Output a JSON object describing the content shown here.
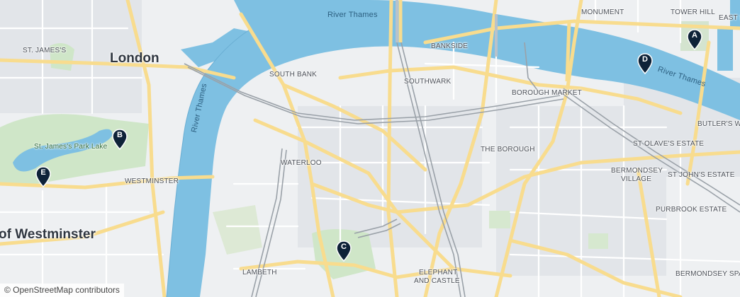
{
  "labels": {
    "river_top": "River Thames",
    "river_left": "River Thames",
    "river_right": "River Thames",
    "london": "London",
    "westminster": "of Westminster",
    "st_jamess": "ST. JAMES'S",
    "st_james_park_lake": "St. James's Park Lake",
    "westminster_small": "WESTMINSTER",
    "south_bank": "SOUTH BANK",
    "waterloo": "WATERLOO",
    "lambeth": "LAMBETH",
    "southwark": "SOUTHWARK",
    "bankside": "BANKSIDE",
    "borough_market": "BOROUGH MARKET",
    "the_borough": "THE BOROUGH",
    "elephant_and_castle_1": "ELEPHANT",
    "elephant_and_castle_2": "AND CASTLE",
    "monument": "MONUMENT",
    "tower_hill": "TOWER HILL",
    "east_sm": "EAST SM",
    "butlers_wharf": "BUTLER'S WHA",
    "st_olaves_estate": "ST OLAVE'S ESTATE",
    "st_johns_estate": "ST JOHN'S ESTATE",
    "bermondsey_village_1": "BERMONDSEY",
    "bermondsey_village_2": "VILLAGE",
    "purbrook_estate": "PURBROOK ESTATE",
    "bermondsey_spa": "BERMONDSEY SPA"
  },
  "markers": [
    {
      "id": "A",
      "letter": "A"
    },
    {
      "id": "B",
      "letter": "B"
    },
    {
      "id": "C",
      "letter": "C"
    },
    {
      "id": "D",
      "letter": "D"
    },
    {
      "id": "E",
      "letter": "E"
    }
  ],
  "attribution": "© OpenStreetMap contributors",
  "colors": {
    "water": "#7ec0e2",
    "land": "#eef0f2",
    "park": "#cfe6c8",
    "major_road": "#f8dc8e",
    "minor_road": "#ffffff",
    "rail": "#9aa1a8",
    "marker": "#0e2238"
  }
}
